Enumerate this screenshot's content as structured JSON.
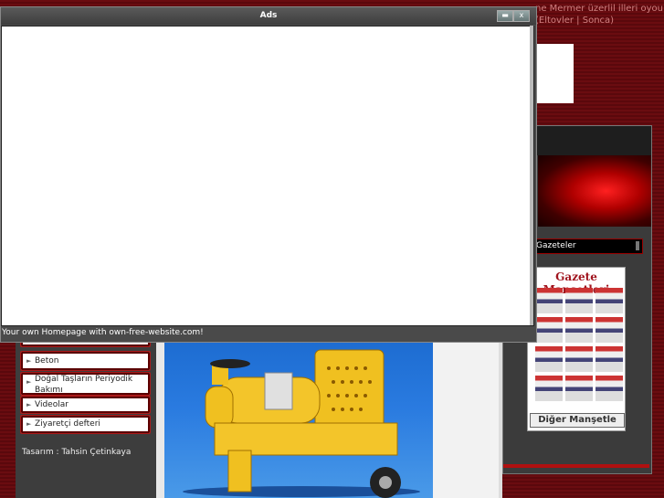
{
  "background": {
    "top_text": "ne Mermer üzerlil illeri oyou (Eltovler | Sonca)"
  },
  "popup": {
    "title": "Ads",
    "minimize_icon": "minimize-icon",
    "close_label": "x",
    "footer_text": "Your own Homepage with own-free-website.com!"
  },
  "sidebar": {
    "items": [
      {
        "label": "Beton"
      },
      {
        "label": "Doğal Taşların Periyodik Bakımı"
      },
      {
        "label": "Videolar"
      },
      {
        "label": "Ziyaretçi defteri"
      }
    ],
    "footer": "Tasarım : Tahsin Çetinkaya"
  },
  "right_panel": {
    "gazeteler_label": "Gazeteler",
    "gazete_title": "Gazete Manşetleri",
    "manset_button": "Diğer Manşetle"
  },
  "colors": {
    "background": "#5a0a0e",
    "accent_red": "#b01010",
    "sky_blue": "#2a7be0"
  }
}
